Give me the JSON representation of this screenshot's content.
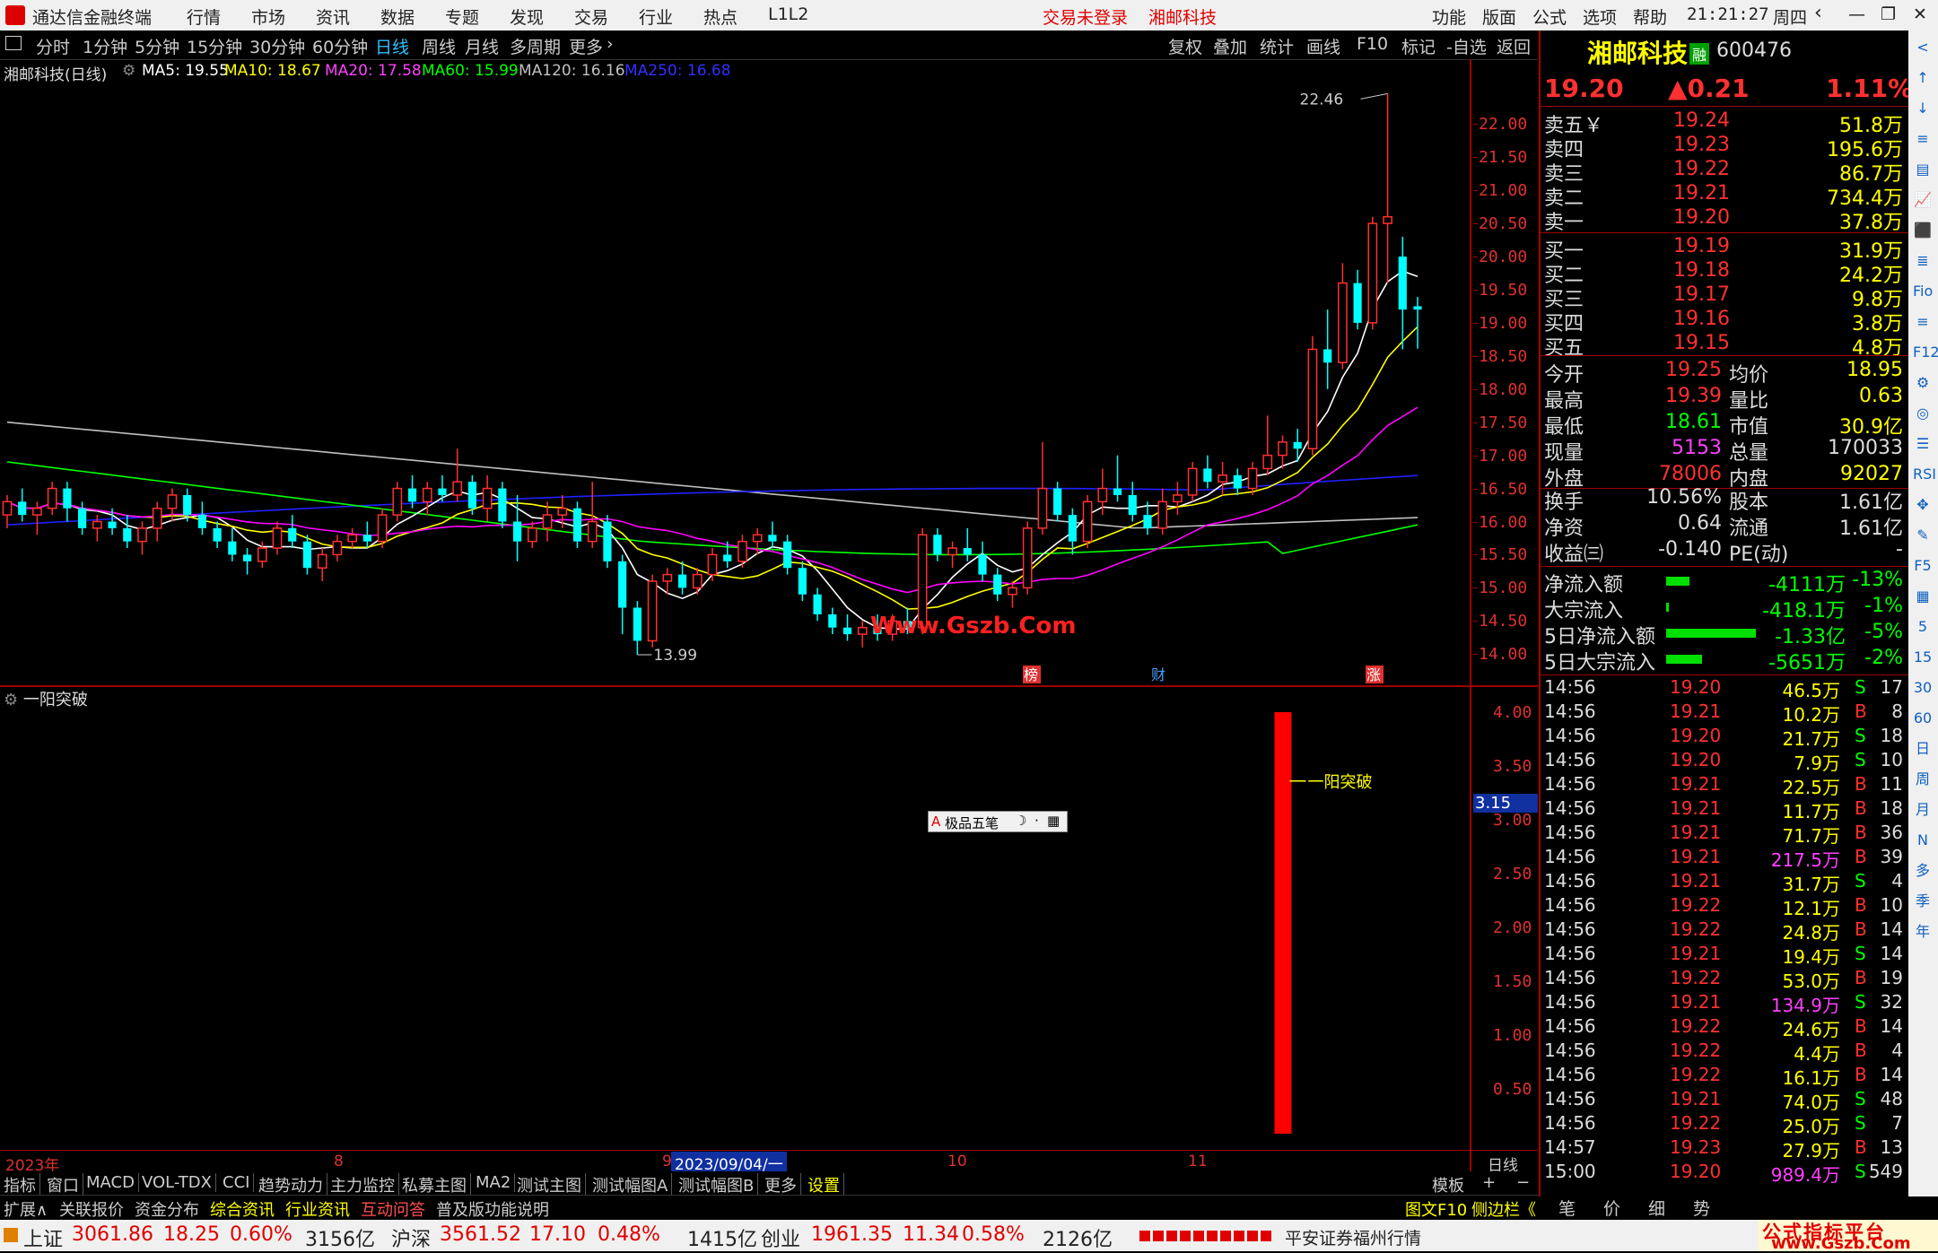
{
  "title": {
    "app": "通达信金融终端",
    "menus": [
      "行情",
      "市场",
      "资讯",
      "数据",
      "专题",
      "发现",
      "交易",
      "行业",
      "热点",
      "L1L2"
    ],
    "login_status": "交易未登录",
    "stock_name": "湘邮科技",
    "right_menus": [
      "功能",
      "版面",
      "公式",
      "选项",
      "帮助"
    ],
    "time": "21:21:27",
    "weekday": "周四"
  },
  "period_bar": {
    "periods": [
      "分时",
      "1分钟",
      "5分钟",
      "15分钟",
      "30分钟",
      "60分钟",
      "日线",
      "周线",
      "月线",
      "多周期",
      "更多"
    ],
    "active": "日线",
    "tools": [
      "复权",
      "叠加",
      "统计",
      "画线",
      "F10",
      "标记",
      "-自选",
      "返回"
    ]
  },
  "ma_line": {
    "stock": "湘邮科技(日线)",
    "ma5": "MA5: 19.55",
    "ma10": "MA10: 18.67",
    "ma20": "MA20: 17.58",
    "ma60": "MA60: 15.99",
    "ma120": "MA120: 16.16",
    "ma250": "MA250: 16.68"
  },
  "colors": {
    "up": "#ff3030",
    "down": "#00ffff",
    "ma5": "#ffffff",
    "ma10": "#ffff00",
    "ma20": "#ff00ff",
    "ma60": "#00ff00",
    "ma120": "#c0c0c0",
    "ma250": "#2020ff"
  },
  "main_chart": {
    "y_ticks": [
      "22.00",
      "21.50",
      "21.00",
      "20.50",
      "20.00",
      "19.50",
      "19.00",
      "18.50",
      "18.00",
      "17.50",
      "17.00",
      "16.50",
      "16.00",
      "15.50",
      "15.00",
      "14.50",
      "14.00"
    ],
    "high_label": "22.46",
    "low_label": "13.99",
    "watermark": "Www.Gszb.Com",
    "markers": [
      "榜",
      "财",
      "涨"
    ]
  },
  "chart_data": {
    "type": "candlestick",
    "ylim": [
      13.8,
      22.6
    ],
    "candles": [
      [
        16.1,
        16.4,
        15.9,
        16.3
      ],
      [
        16.3,
        16.5,
        16.0,
        16.1
      ],
      [
        16.1,
        16.3,
        15.8,
        16.2
      ],
      [
        16.2,
        16.6,
        16.1,
        16.5
      ],
      [
        16.5,
        16.6,
        16.0,
        16.2
      ],
      [
        16.2,
        16.3,
        15.8,
        15.9
      ],
      [
        15.9,
        16.1,
        15.7,
        16.0
      ],
      [
        16.0,
        16.2,
        15.8,
        15.9
      ],
      [
        15.9,
        16.1,
        15.6,
        15.7
      ],
      [
        15.7,
        16.0,
        15.5,
        15.9
      ],
      [
        15.9,
        16.3,
        15.7,
        16.2
      ],
      [
        16.2,
        16.5,
        16.0,
        16.4
      ],
      [
        16.4,
        16.5,
        16.0,
        16.1
      ],
      [
        16.1,
        16.3,
        15.8,
        15.9
      ],
      [
        15.9,
        16.0,
        15.6,
        15.7
      ],
      [
        15.7,
        15.9,
        15.4,
        15.5
      ],
      [
        15.5,
        15.6,
        15.2,
        15.4
      ],
      [
        15.4,
        15.7,
        15.3,
        15.6
      ],
      [
        15.6,
        16.0,
        15.5,
        15.9
      ],
      [
        15.9,
        16.1,
        15.6,
        15.7
      ],
      [
        15.7,
        15.8,
        15.2,
        15.3
      ],
      [
        15.3,
        15.6,
        15.1,
        15.5
      ],
      [
        15.5,
        15.8,
        15.4,
        15.7
      ],
      [
        15.7,
        15.9,
        15.6,
        15.8
      ],
      [
        15.8,
        16.0,
        15.6,
        15.7
      ],
      [
        15.7,
        16.2,
        15.6,
        16.1
      ],
      [
        16.1,
        16.6,
        16.0,
        16.5
      ],
      [
        16.5,
        16.7,
        16.2,
        16.3
      ],
      [
        16.3,
        16.6,
        16.1,
        16.5
      ],
      [
        16.5,
        16.7,
        16.3,
        16.4
      ],
      [
        16.4,
        17.1,
        16.3,
        16.6
      ],
      [
        16.6,
        16.7,
        16.1,
        16.2
      ],
      [
        16.2,
        16.7,
        16.0,
        16.5
      ],
      [
        16.5,
        16.6,
        15.9,
        16.0
      ],
      [
        16.0,
        16.4,
        15.4,
        15.7
      ],
      [
        15.7,
        16.0,
        15.6,
        15.9
      ],
      [
        15.9,
        16.3,
        15.7,
        16.1
      ],
      [
        16.1,
        16.4,
        15.9,
        16.2
      ],
      [
        16.2,
        16.3,
        15.6,
        15.7
      ],
      [
        15.7,
        16.6,
        15.6,
        16.0
      ],
      [
        16.0,
        16.1,
        15.3,
        15.4
      ],
      [
        15.4,
        15.5,
        14.3,
        14.7
      ],
      [
        14.7,
        14.8,
        13.99,
        14.2
      ],
      [
        14.2,
        15.2,
        14.1,
        15.1
      ],
      [
        15.1,
        15.3,
        14.9,
        15.2
      ],
      [
        15.2,
        15.4,
        14.9,
        15.0
      ],
      [
        15.0,
        15.3,
        14.9,
        15.2
      ],
      [
        15.2,
        15.6,
        15.1,
        15.5
      ],
      [
        15.5,
        15.7,
        15.3,
        15.4
      ],
      [
        15.4,
        15.8,
        15.3,
        15.7
      ],
      [
        15.7,
        15.9,
        15.5,
        15.8
      ],
      [
        15.8,
        16.0,
        15.6,
        15.7
      ],
      [
        15.7,
        15.8,
        15.2,
        15.3
      ],
      [
        15.3,
        15.4,
        14.8,
        14.9
      ],
      [
        14.9,
        15.0,
        14.5,
        14.6
      ],
      [
        14.6,
        14.7,
        14.3,
        14.4
      ],
      [
        14.4,
        14.6,
        14.2,
        14.3
      ],
      [
        14.3,
        14.5,
        14.1,
        14.4
      ],
      [
        14.4,
        14.6,
        14.2,
        14.3
      ],
      [
        14.3,
        14.6,
        14.2,
        14.5
      ],
      [
        14.5,
        14.7,
        14.3,
        14.4
      ],
      [
        14.4,
        15.9,
        14.3,
        15.8
      ],
      [
        15.8,
        15.9,
        15.4,
        15.5
      ],
      [
        15.5,
        15.7,
        15.3,
        15.6
      ],
      [
        15.6,
        15.9,
        15.4,
        15.5
      ],
      [
        15.5,
        15.7,
        15.1,
        15.2
      ],
      [
        15.2,
        15.3,
        14.8,
        14.9
      ],
      [
        14.9,
        15.1,
        14.7,
        15.0
      ],
      [
        15.0,
        16.0,
        14.9,
        15.9
      ],
      [
        15.9,
        17.2,
        15.8,
        16.5
      ],
      [
        16.5,
        16.6,
        16.0,
        16.1
      ],
      [
        16.1,
        16.2,
        15.5,
        15.7
      ],
      [
        15.7,
        16.4,
        15.6,
        16.3
      ],
      [
        16.3,
        16.8,
        16.1,
        16.5
      ],
      [
        16.5,
        17.0,
        16.3,
        16.4
      ],
      [
        16.4,
        16.6,
        16.0,
        16.1
      ],
      [
        16.1,
        16.3,
        15.8,
        15.9
      ],
      [
        15.9,
        16.5,
        15.8,
        16.3
      ],
      [
        16.3,
        16.6,
        16.1,
        16.4
      ],
      [
        16.4,
        16.9,
        16.3,
        16.8
      ],
      [
        16.8,
        17.0,
        16.5,
        16.6
      ],
      [
        16.6,
        16.9,
        16.4,
        16.7
      ],
      [
        16.7,
        16.8,
        16.4,
        16.5
      ],
      [
        16.5,
        16.9,
        16.4,
        16.8
      ],
      [
        16.8,
        17.6,
        16.7,
        17.0
      ],
      [
        17.0,
        17.3,
        16.8,
        17.2
      ],
      [
        17.2,
        17.4,
        16.9,
        17.1
      ],
      [
        17.1,
        18.8,
        17.0,
        18.6
      ],
      [
        18.6,
        19.2,
        18.0,
        18.4
      ],
      [
        18.4,
        19.9,
        18.3,
        19.6
      ],
      [
        19.6,
        19.8,
        18.9,
        19.0
      ],
      [
        19.0,
        20.6,
        18.9,
        20.5
      ],
      [
        20.5,
        22.46,
        19.6,
        20.6
      ],
      [
        20.0,
        20.3,
        18.6,
        19.2
      ],
      [
        19.25,
        19.39,
        18.61,
        19.2
      ]
    ]
  },
  "indicator": {
    "name": "一阳突破",
    "y_ticks": [
      "4.00",
      "3.50",
      "3.00",
      "2.50",
      "2.00",
      "1.50",
      "1.00",
      "0.50"
    ],
    "current_value": "3.15",
    "signal_label": "一阳突破",
    "bar_value": 4.0,
    "popup": "极品五笔"
  },
  "x_axis": {
    "labels": [
      "2023年",
      "8",
      "9",
      "2023/09/04/一",
      "10",
      "11"
    ],
    "period": "日线"
  },
  "quote": {
    "name": "湘邮科技",
    "tag": "融",
    "code": "600476",
    "price": "19.20",
    "change": "▲0.21",
    "pct": "1.11%",
    "asks": [
      {
        "label": "卖五￥",
        "price": "19.24",
        "vol": "51.8万"
      },
      {
        "label": "卖四",
        "price": "19.23",
        "vol": "195.6万"
      },
      {
        "label": "卖三",
        "price": "19.22",
        "vol": "86.7万"
      },
      {
        "label": "卖二",
        "price": "19.21",
        "vol": "734.4万"
      },
      {
        "label": "卖一",
        "price": "19.20",
        "vol": "37.8万"
      }
    ],
    "bids": [
      {
        "label": "买一",
        "price": "19.19",
        "vol": "31.9万"
      },
      {
        "label": "买二",
        "price": "19.18",
        "vol": "24.2万"
      },
      {
        "label": "买三",
        "price": "19.17",
        "vol": "9.8万"
      },
      {
        "label": "买四",
        "price": "19.16",
        "vol": "3.8万"
      },
      {
        "label": "买五",
        "price": "19.15",
        "vol": "4.8万"
      }
    ],
    "stats": [
      {
        "l1": "今开",
        "v1": "19.25",
        "l2": "均价",
        "v2": "18.95"
      },
      {
        "l1": "最高",
        "v1": "19.39",
        "l2": "量比",
        "v2": "0.63"
      },
      {
        "l1": "最低",
        "v1": "18.61",
        "l2": "市值",
        "v2": "30.9亿"
      },
      {
        "l1": "现量",
        "v1": "5153",
        "l2": "总量",
        "v2": "170033"
      },
      {
        "l1": "外盘",
        "v1": "78006",
        "l2": "内盘",
        "v2": "92027"
      }
    ],
    "stats2": [
      {
        "l1": "换手",
        "v1": "10.56%",
        "l2": "股本",
        "v2": "1.61亿"
      },
      {
        "l1": "净资",
        "v1": "0.64",
        "l2": "流通",
        "v2": "1.61亿"
      },
      {
        "l1": "收益㈢",
        "v1": "-0.140",
        "l2": "PE(动)",
        "v2": "-"
      }
    ],
    "flows": [
      {
        "label": "净流入额",
        "value": "-4111万",
        "pct": "-13%",
        "bar": 0.13
      },
      {
        "label": "大宗流入",
        "value": "-418.1万",
        "pct": "-1%",
        "bar": 0.01
      },
      {
        "label": "5日净流入额",
        "value": "-1.33亿",
        "pct": "-5%",
        "bar": 0.5
      },
      {
        "label": "5日大宗流入",
        "value": "-5651万",
        "pct": "-2%",
        "bar": 0.2
      }
    ],
    "ticks": [
      {
        "t": "14:56",
        "p": "19.20",
        "v": "46.5万",
        "s": "S",
        "n": "17"
      },
      {
        "t": "14:56",
        "p": "19.21",
        "v": "10.2万",
        "s": "B",
        "n": "8"
      },
      {
        "t": "14:56",
        "p": "19.20",
        "v": "21.7万",
        "s": "S",
        "n": "18"
      },
      {
        "t": "14:56",
        "p": "19.20",
        "v": "7.9万",
        "s": "S",
        "n": "10"
      },
      {
        "t": "14:56",
        "p": "19.21",
        "v": "22.5万",
        "s": "B",
        "n": "11"
      },
      {
        "t": "14:56",
        "p": "19.21",
        "v": "11.7万",
        "s": "B",
        "n": "18"
      },
      {
        "t": "14:56",
        "p": "19.21",
        "v": "71.7万",
        "s": "B",
        "n": "36"
      },
      {
        "t": "14:56",
        "p": "19.21",
        "v": "217.5万",
        "s": "B",
        "n": "39"
      },
      {
        "t": "14:56",
        "p": "19.21",
        "v": "31.7万",
        "s": "S",
        "n": "4"
      },
      {
        "t": "14:56",
        "p": "19.22",
        "v": "12.1万",
        "s": "B",
        "n": "10"
      },
      {
        "t": "14:56",
        "p": "19.22",
        "v": "24.8万",
        "s": "B",
        "n": "14"
      },
      {
        "t": "14:56",
        "p": "19.21",
        "v": "19.4万",
        "s": "S",
        "n": "14"
      },
      {
        "t": "14:56",
        "p": "19.22",
        "v": "53.0万",
        "s": "B",
        "n": "19"
      },
      {
        "t": "14:56",
        "p": "19.21",
        "v": "134.9万",
        "s": "S",
        "n": "32"
      },
      {
        "t": "14:56",
        "p": "19.22",
        "v": "24.6万",
        "s": "B",
        "n": "14"
      },
      {
        "t": "14:56",
        "p": "19.22",
        "v": "4.4万",
        "s": "B",
        "n": "4"
      },
      {
        "t": "14:56",
        "p": "19.22",
        "v": "16.1万",
        "s": "B",
        "n": "14"
      },
      {
        "t": "14:56",
        "p": "19.21",
        "v": "74.0万",
        "s": "S",
        "n": "48"
      },
      {
        "t": "14:56",
        "p": "19.22",
        "v": "25.0万",
        "s": "S",
        "n": "7"
      },
      {
        "t": "14:57",
        "p": "19.23",
        "v": "27.9万",
        "s": "B",
        "n": "13"
      },
      {
        "t": "15:00",
        "p": "19.20",
        "v": "989.4万",
        "s": "S",
        "n": "549"
      }
    ],
    "bottom_tabs": [
      "笔",
      "价",
      "细",
      "势"
    ]
  },
  "side_icons": [
    "<",
    "↑",
    "↓",
    "≡",
    "▤",
    "📈",
    "⬛",
    "≣",
    "Fio",
    "≡",
    "F12",
    "⚙",
    "◎",
    "☰",
    "RSI",
    "✥",
    "✎",
    "F5",
    "▦",
    "5",
    "15",
    "30",
    "60",
    "日",
    "周",
    "月",
    "N",
    "多",
    "季",
    "年"
  ],
  "tabbar": {
    "items": [
      "指标",
      "窗口",
      "MACD",
      "VOL-TDX",
      "CCI",
      "趋势动力",
      "主力监控",
      "私募主图",
      "MA2",
      "测试主图",
      "测试幅图A",
      "测试幅图B",
      "更多",
      "设置"
    ],
    "active": "设置",
    "right": [
      "模板",
      "+",
      "−"
    ]
  },
  "expbar": {
    "items": [
      "扩展∧",
      "关联报价",
      "资金分布",
      "综合资讯",
      "行业资讯",
      "互动问答",
      "普及版功能说明"
    ],
    "right": "图文F10",
    "right2": "侧边栏《"
  },
  "status": {
    "idx1_name": "上证",
    "idx1_val": "3061.86",
    "idx1_chg": "18.25",
    "idx1_pct": "0.60%",
    "idx1_amt": "3156亿",
    "idx2_name": "沪深",
    "idx2_val": "3561.52",
    "idx2_chg": "17.10",
    "idx2_pct": "0.48%",
    "idx2_amt": "1415亿",
    "idx3_name": "创业",
    "idx3_val": "1961.35",
    "idx3_chg": "11.34",
    "idx3_pct": "0.58%",
    "idx3_amt": "2126亿",
    "broker": "平安证券福州行情",
    "logo_top": "公式指标平台",
    "logo_bottom": "www.Gszb.Com"
  }
}
